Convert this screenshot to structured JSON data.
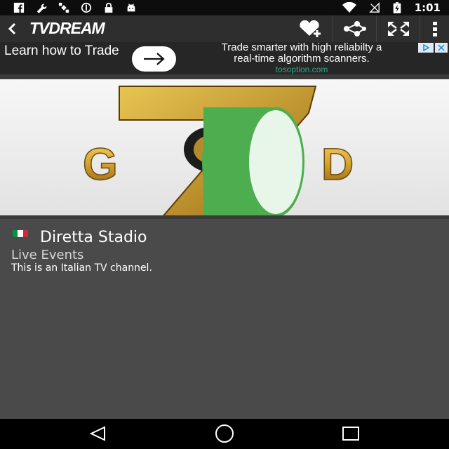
{
  "status_bar": {
    "time": "1:01",
    "icons_left": [
      "facebook-icon",
      "wrench-icon",
      "satellite-icon",
      "blocked-icon",
      "lock-icon",
      "android-icon"
    ],
    "icons_right": [
      "wifi-icon",
      "no-signal-icon",
      "battery-charging-icon"
    ]
  },
  "action_bar": {
    "title": "TVDREAM",
    "actions": [
      "favorite-add-icon",
      "share-icon",
      "fullscreen-icon",
      "overflow-menu-icon"
    ]
  },
  "ad": {
    "learn_text": "Learn how to Trade",
    "headline_line1": "Trade smarter with high reliabilty a",
    "headline_line2": "real-time algorithm scanners.",
    "domain": "tosoption.com"
  },
  "channel": {
    "name": "Diretta Stadio",
    "category": "Live Events",
    "description": "This is an Italian TV channel.",
    "flag_colors": [
      "#009246",
      "#ffffff",
      "#ce2b37"
    ],
    "logo_letters": [
      "G",
      "D"
    ],
    "logo_numeral": "7"
  },
  "colors": {
    "loading_spinner": "#4cae4f",
    "logo_gold": "#d8a631"
  }
}
